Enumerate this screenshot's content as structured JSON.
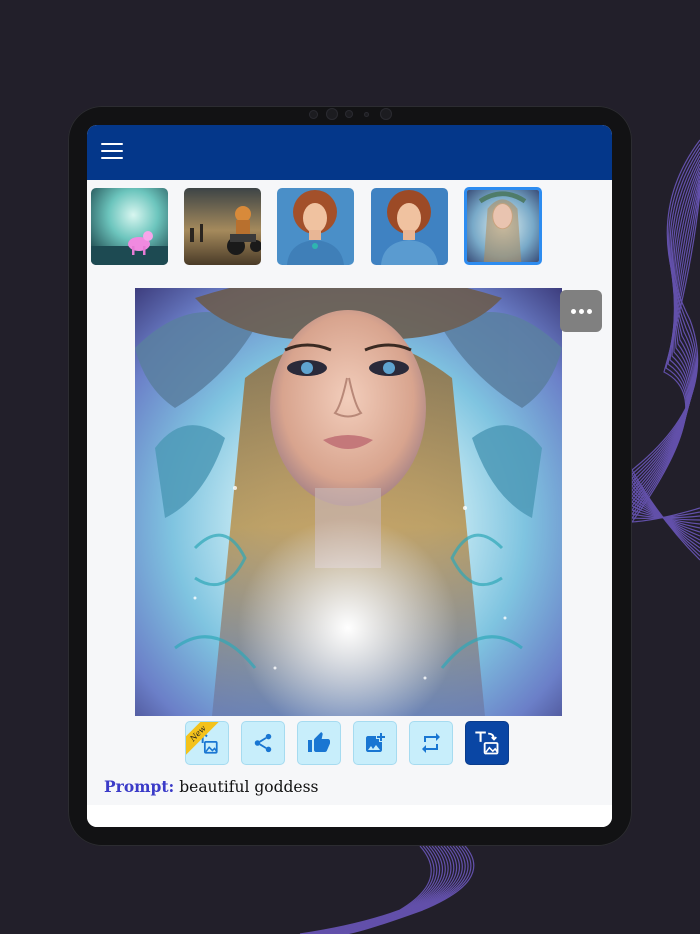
{
  "app": {
    "menu_icon": "hamburger-menu-icon",
    "more_icon": "ellipsis-icon"
  },
  "colors": {
    "background": "#221f2a",
    "app_bar": "#04378a",
    "action_bg": "#c8eefb",
    "action_active": "#0a46a4",
    "selected_border": "#2d8cf0",
    "prompt_label": "#3b3bc8",
    "new_badge": "#f3c21b"
  },
  "thumbnails": [
    {
      "name": "thumb-pink-unicorn",
      "selected": false
    },
    {
      "name": "thumb-tiger-motorcycle",
      "selected": false
    },
    {
      "name": "thumb-redhead-woman-1",
      "selected": false
    },
    {
      "name": "thumb-redhead-woman-2",
      "selected": false
    },
    {
      "name": "thumb-goddess",
      "selected": true
    }
  ],
  "actions": [
    {
      "icon": "image-transform-icon",
      "badge": "New"
    },
    {
      "icon": "share-icon"
    },
    {
      "icon": "thumbs-up-icon"
    },
    {
      "icon": "add-image-icon"
    },
    {
      "icon": "repeat-icon"
    },
    {
      "icon": "text-to-image-icon",
      "active": true
    }
  ],
  "prompt": {
    "label": "Prompt:",
    "text": "beautiful goddess"
  }
}
